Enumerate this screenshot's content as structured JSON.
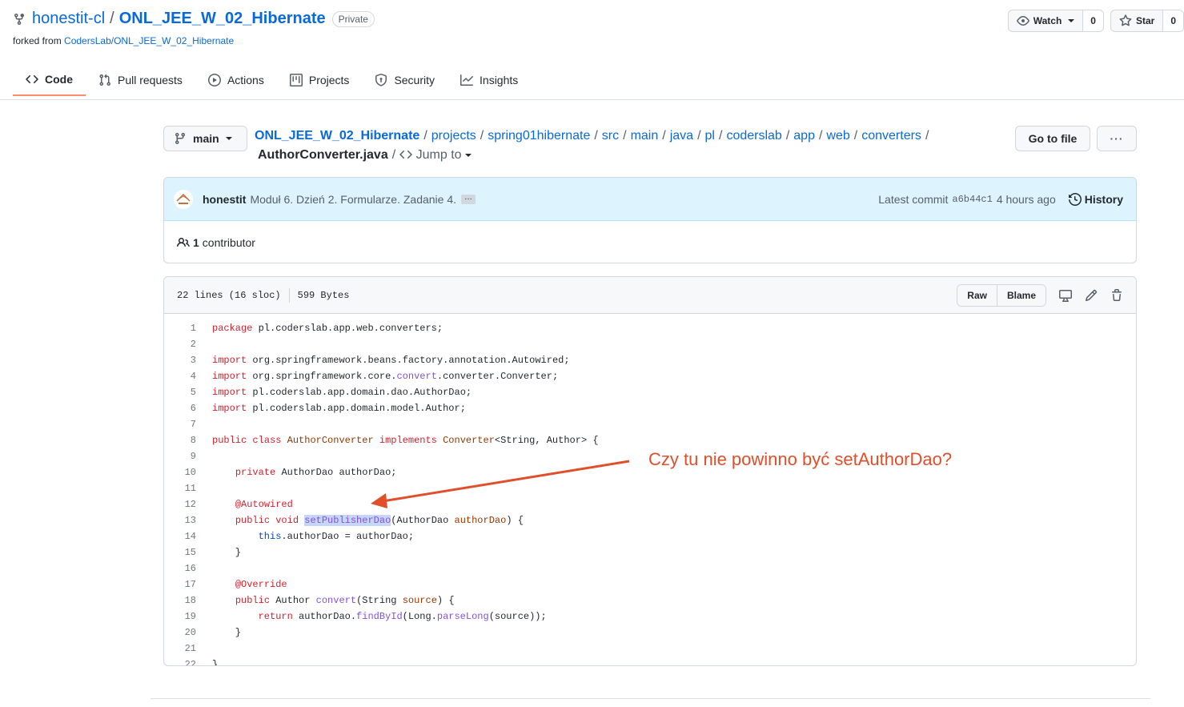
{
  "repo": {
    "owner": "honestit-cl",
    "separator": "/",
    "name": "ONL_JEE_W_02_Hibernate",
    "visibility": "Private",
    "forked_prefix": "forked from ",
    "forked_from": "CodersLab/ONL_JEE_W_02_Hibernate"
  },
  "header_actions": {
    "watch_label": "Watch",
    "watch_count": "0",
    "star_label": "Star",
    "star_count": "0"
  },
  "tabs": [
    {
      "label": "Code",
      "icon": "code-icon",
      "active": true
    },
    {
      "label": "Pull requests",
      "icon": "pull-request-icon"
    },
    {
      "label": "Actions",
      "icon": "play-icon"
    },
    {
      "label": "Projects",
      "icon": "project-icon"
    },
    {
      "label": "Security",
      "icon": "shield-icon"
    },
    {
      "label": "Insights",
      "icon": "graph-icon"
    }
  ],
  "branch": "main",
  "breadcrumb": {
    "root": "ONL_JEE_W_02_Hibernate",
    "parts": [
      "projects",
      "spring01hibernate",
      "src",
      "main",
      "java",
      "pl",
      "coderslab",
      "app",
      "web",
      "converters"
    ],
    "file": "AuthorConverter.java",
    "jump": "Jump to"
  },
  "goto_file": "Go to file",
  "more": "···",
  "commit": {
    "author": "honestit",
    "message": "Moduł 6. Dzień 2. Formularze. Zadanie 4.",
    "ellipsis": "…",
    "latest_label": "Latest commit",
    "sha": "a6b44c1",
    "time": "4 hours ago",
    "history": "History"
  },
  "contributors": {
    "count": "1",
    "label": "contributor"
  },
  "file_info": {
    "lines": "22 lines (16 sloc)",
    "size": "599 Bytes",
    "raw": "Raw",
    "blame": "Blame"
  },
  "code_lines": [
    "package pl.coderslab.app.web.converters;",
    "",
    "import org.springframework.beans.factory.annotation.Autowired;",
    "import org.springframework.core.convert.converter.Converter;",
    "import pl.coderslab.app.domain.dao.AuthorDao;",
    "import pl.coderslab.app.domain.model.Author;",
    "",
    "public class AuthorConverter implements Converter<String, Author> {",
    "",
    "    private AuthorDao authorDao;",
    "",
    "    @Autowired",
    "    public void setPublisherDao(AuthorDao authorDao) {",
    "        this.authorDao = authorDao;",
    "    }",
    "",
    "    @Override",
    "    public Author convert(String source) {",
    "        return authorDao.findById(Long.parseLong(source));",
    "    }",
    "",
    "}"
  ],
  "annotation": "Czy tu nie powinno być setAuthorDao?",
  "colors": {
    "link": "#0969da",
    "annotation": "#e04e2a",
    "tab_active_underline": "#fd8c73",
    "commit_bg": "#ddf4ff"
  }
}
